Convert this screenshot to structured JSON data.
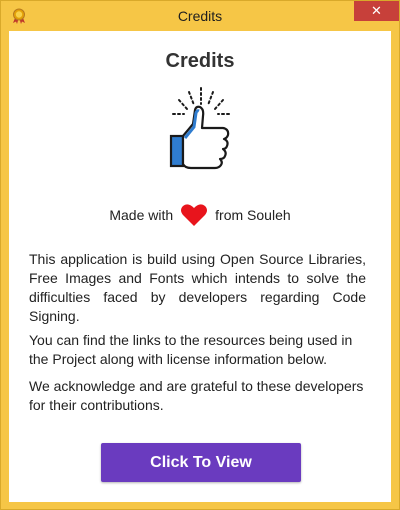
{
  "window": {
    "title": "Credits",
    "close_symbol": "✕",
    "app_icon": "badge-icon",
    "frame_color": "#f6c646"
  },
  "content": {
    "heading": "Credits",
    "illustration": "thumbs-up-icon",
    "made_with": {
      "before": "Made with",
      "icon": "heart-icon",
      "after": "from Souleh"
    },
    "paragraphs": [
      "This application is build using Open Source Libraries, Free Images and Fonts which intends to solve the difficulties faced by developers regarding Code Signing.",
      "You can find the links to the resources being used in the Project along with license information below.",
      "We acknowledge and are grateful to these developers for their contributions."
    ],
    "button_label": "Click To View",
    "button_color": "#6a3bbf",
    "heart_color": "#e8141c"
  }
}
